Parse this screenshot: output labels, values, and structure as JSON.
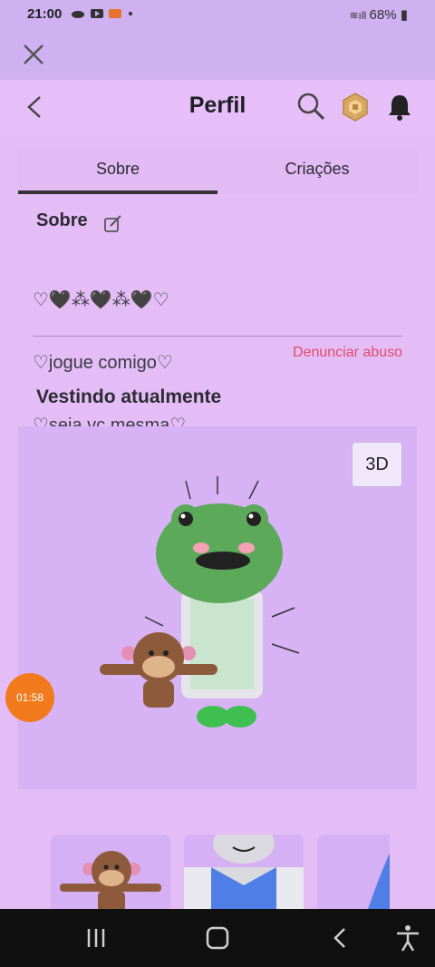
{
  "status_bar": {
    "time": "21:00",
    "battery": "68%"
  },
  "header": {
    "title": "Perfil"
  },
  "tabs": [
    {
      "label": "Sobre"
    },
    {
      "label": "Criações"
    }
  ],
  "about": {
    "heading": "Sobre",
    "bio_lines": [
      "♡🖤⁂🖤⁂🖤♡",
      "♡jogue comigo♡",
      "♡seja vc mesma♡"
    ],
    "report_label": "Denunciar abuso"
  },
  "wearing": {
    "heading": "Vestindo atualmente",
    "view_3d_label": "3D"
  },
  "recording": {
    "timer": "01:58"
  },
  "colors": {
    "accent_report": "#e24a6a",
    "background": "#e5bdf6",
    "recording": "#f07a1c"
  }
}
